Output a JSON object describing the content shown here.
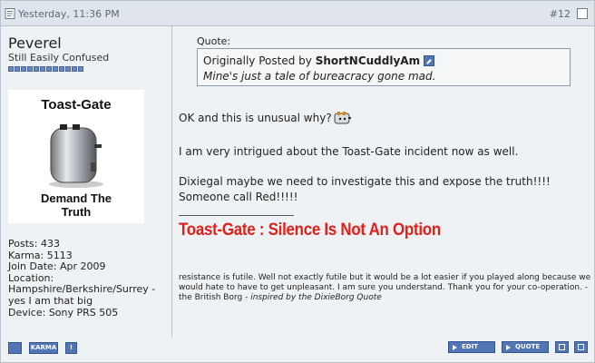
{
  "header": {
    "date": "Yesterday, 11:36 PM",
    "post_number": "#12"
  },
  "user": {
    "name": "Peverel",
    "title": "Still Easily Confused",
    "reputation_pips": 12,
    "avatar": {
      "top_text": "Toast-Gate",
      "bottom_line1": "Demand The",
      "bottom_line2": "Truth"
    },
    "info": [
      "Posts: 433",
      "Karma: 5113",
      "Join Date: Apr 2009",
      "Location:",
      "Hampshire/Berkshire/Surrey -",
      "yes I am that big",
      "Device: Sony PRS 505"
    ]
  },
  "quote": {
    "label": "Quote:",
    "prefix": "Originally Posted by",
    "author": "ShortNCuddlyAm",
    "text": "Mine's just a tale of bureacracy gone mad."
  },
  "message": {
    "line1": "OK and this is unusual why?",
    "line2": "I am very intrigued about the Toast-Gate incident now as well.",
    "line3": "Dixiegal maybe we need to investigate this and expose the truth!!!!",
    "line4": "Someone call Red!!!!!"
  },
  "signature": {
    "headline": "Toast-Gate : Silence Is Not An Option",
    "borg_text": "resistance is futile. Well not exactly futile but it would be a lot easier if you played along because we would hate to have to get unpleasant. I am sure you understand. Thank you for your co-operation.",
    "borg_sign": "- the British Borg -",
    "borg_inspired": "inspired by the DixieBorg Quote"
  },
  "footer": {
    "karma_label": "KARMA",
    "report_label": "!",
    "edit_label": "EDIT",
    "quote_label": "QUOTE"
  },
  "colors": {
    "headline_red": "#e0201a",
    "button_blue": "#5276b5",
    "panel_bg": "#eef2f5"
  }
}
